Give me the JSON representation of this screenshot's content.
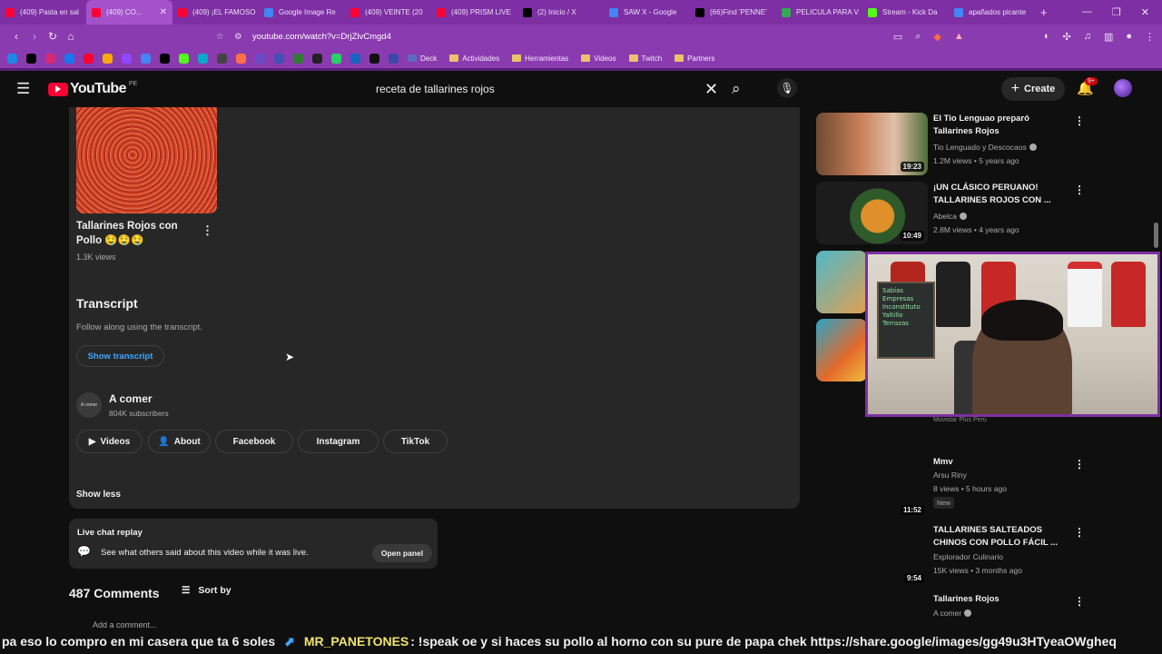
{
  "browser": {
    "tabs": [
      {
        "title": "(409) Pasta en sal",
        "color": "#ff0033"
      },
      {
        "title": "(409) CO...",
        "color": "#ff0033",
        "active": true
      },
      {
        "title": "(409) ¡EL FAMOSO",
        "color": "#ff0033"
      },
      {
        "title": "Google Image Re",
        "color": "#4285f4"
      },
      {
        "title": "(409) VEINTE (20",
        "color": "#ff0033"
      },
      {
        "title": "(409) PRISM LIVE",
        "color": "#ff0033"
      },
      {
        "title": "(2) Inicio / X",
        "color": "#000000"
      },
      {
        "title": "SAW X - Google",
        "color": "#4285f4"
      },
      {
        "title": "(66)Find 'PENNE'",
        "color": "#000000"
      },
      {
        "title": "PELICULA PARA V",
        "color": "#34a853"
      },
      {
        "title": "Stream - Kick Da",
        "color": "#53fc18"
      },
      {
        "title": "apañados picante",
        "color": "#4285f4"
      }
    ],
    "url": "youtube.com/watch?v=DrjZlvCmgd4",
    "bookmarks": [
      "Deck",
      "Actividades",
      "Herramientas",
      "Videos",
      "Twitch",
      "Partners"
    ]
  },
  "header": {
    "logo_text": "YouTube",
    "country": "PE",
    "search_query": "receta de tallarines rojos",
    "create_label": "Create",
    "notif_badge": "9+"
  },
  "main": {
    "card": {
      "title": "Tallarines Rojos con Pollo 🤤🤤🤤",
      "views": "1.3K views"
    },
    "transcript": {
      "heading": "Transcript",
      "subtitle": "Follow along using the transcript.",
      "button": "Show transcript"
    },
    "channel": {
      "name": "A comer",
      "subs": "804K subscribers",
      "avatar_text": "A comer"
    },
    "chips": [
      "Videos",
      "About",
      "Facebook",
      "Instagram",
      "TikTok"
    ],
    "show_less": "Show less",
    "live_chat": {
      "heading": "Live chat replay",
      "text": "See what others said about this video while it was live.",
      "button": "Open panel"
    },
    "comments": {
      "count": "487 Comments",
      "sort": "Sort by",
      "add": "Add a comment..."
    }
  },
  "sidebar": {
    "items": [
      {
        "title": "El Tio Lenguao preparó Tallarines Rojos",
        "channel": "Tio Lenguado y Descocaos",
        "meta": "1.2M views • 5 years ago",
        "duration": "19:23"
      },
      {
        "title": "¡UN CLÁSICO PERUANO! TALLARINES ROJOS CON ...",
        "channel": "Abelca",
        "meta": "2.8M views • 4 years ago",
        "duration": "10:49"
      },
      {
        "title": "Mmv",
        "channel": "Arsu Riny",
        "meta": "8 views • 5 hours ago",
        "duration": "11:52",
        "badge": "New"
      },
      {
        "title": "TALLARINES SALTEADOS CHINOS CON POLLO FÁCIL ...",
        "channel": "Explorador Culinario",
        "meta": "15K views • 3 months ago",
        "duration": "9:54"
      },
      {
        "title": "Tallarines Rojos",
        "channel": "A comer",
        "meta": "",
        "duration": ""
      }
    ],
    "partial_text": "Movistar Plus Perú"
  },
  "webcam": {
    "board_lines": [
      "Sabías",
      "Empresas",
      "Inconstituto",
      "Yaltillo",
      "Terrazas"
    ]
  },
  "ticker": {
    "lead": "pa eso lo compro en mi casera que ta 6 soles",
    "user": "MR_PANETONES",
    "message": ": !speak oe y si haces su pollo al horno con su pure de papa chek https://share.google/images/gg49u3HTyeaOWgheq"
  },
  "colors": {
    "accent": "#3ea6ff",
    "browser": "#8b3bb0",
    "youtube_red": "#ff0033"
  }
}
